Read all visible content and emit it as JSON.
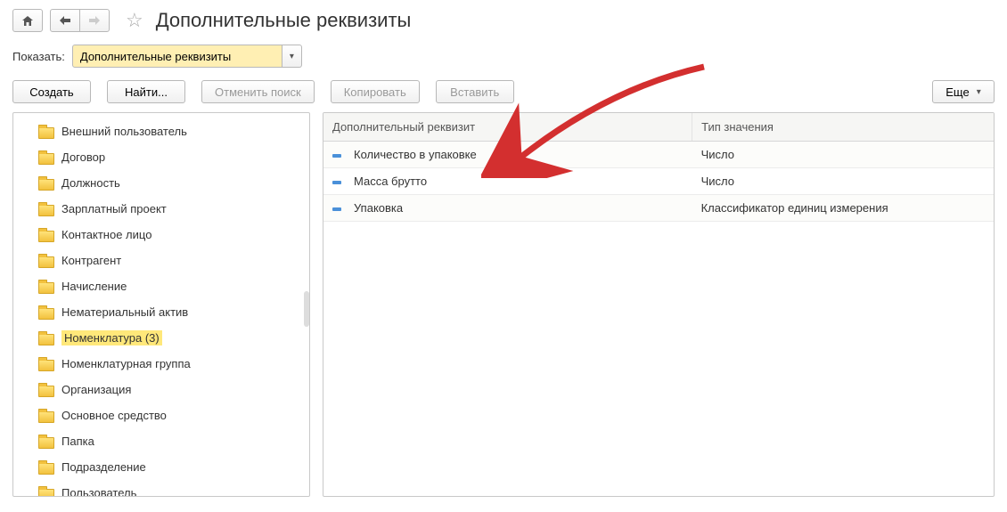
{
  "header": {
    "title": "Дополнительные реквизиты"
  },
  "filter": {
    "label": "Показать:",
    "value": "Дополнительные реквизиты"
  },
  "toolbar": {
    "create": "Создать",
    "find": "Найти...",
    "cancel_search": "Отменить поиск",
    "copy": "Копировать",
    "paste": "Вставить",
    "more": "Еще"
  },
  "tree": {
    "items": [
      {
        "label": "Внешний пользователь"
      },
      {
        "label": "Договор"
      },
      {
        "label": "Должность"
      },
      {
        "label": "Зарплатный проект"
      },
      {
        "label": "Контактное лицо"
      },
      {
        "label": "Контрагент"
      },
      {
        "label": "Начисление"
      },
      {
        "label": "Нематериальный актив"
      },
      {
        "label": "Номенклатура (3)",
        "highlight": true
      },
      {
        "label": "Номенклатурная группа"
      },
      {
        "label": "Организация"
      },
      {
        "label": "Основное средство"
      },
      {
        "label": "Папка"
      },
      {
        "label": "Подразделение"
      },
      {
        "label": "Пользователь"
      }
    ]
  },
  "table": {
    "columns": [
      "Дополнительный реквизит",
      "Тип значения"
    ],
    "rows": [
      {
        "name": "Количество в упаковке",
        "type": "Число"
      },
      {
        "name": "Масса брутто",
        "type": "Число"
      },
      {
        "name": "Упаковка",
        "type": "Классификатор единиц измерения"
      }
    ]
  }
}
